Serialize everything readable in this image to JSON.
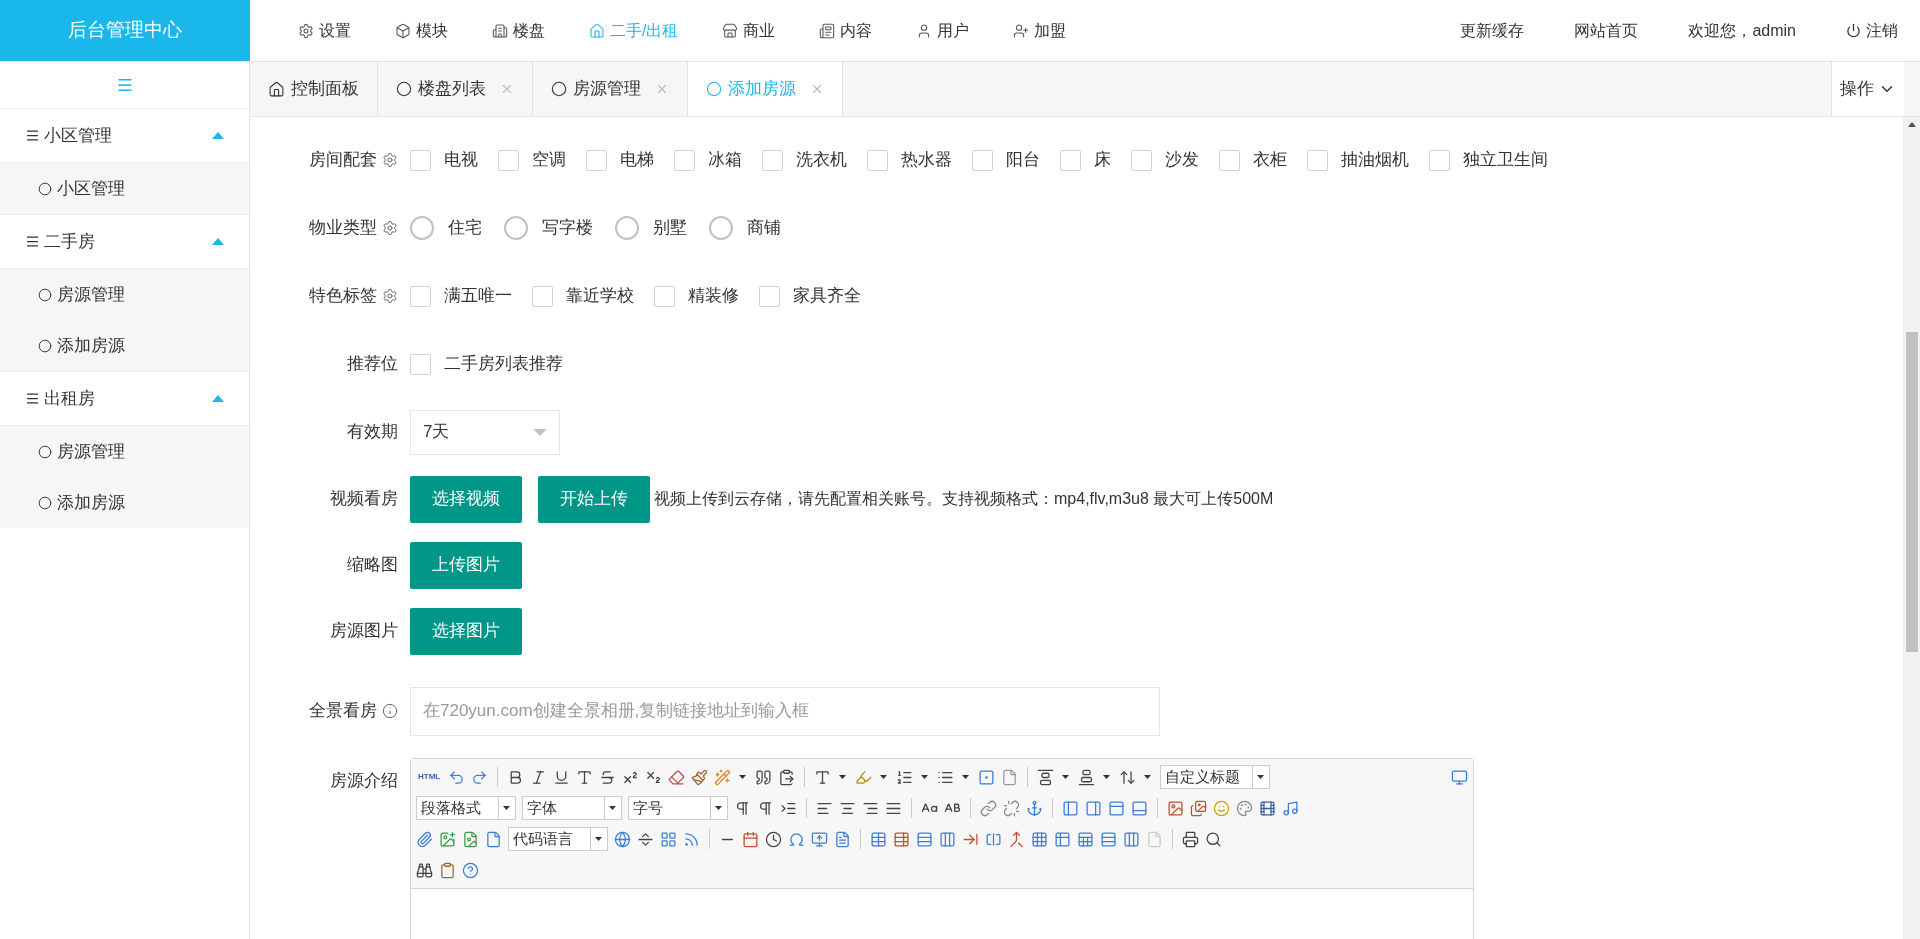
{
  "header": {
    "logo": "后台管理中心",
    "nav": [
      {
        "label": "设置",
        "selected": false
      },
      {
        "label": "模块",
        "selected": false
      },
      {
        "label": "楼盘",
        "selected": false
      },
      {
        "label": "二手/出租",
        "selected": true
      },
      {
        "label": "商业",
        "selected": false
      },
      {
        "label": "内容",
        "selected": false
      },
      {
        "label": "用户",
        "selected": false
      },
      {
        "label": "加盟",
        "selected": false
      }
    ],
    "links": [
      "更新缓存",
      "网站首页"
    ],
    "welcome": "欢迎您，admin",
    "logout": "注销"
  },
  "sidebar": {
    "groups": [
      {
        "title": "小区管理",
        "expanded": true,
        "items": [
          {
            "label": "小区管理",
            "selected": false
          }
        ]
      },
      {
        "title": "二手房",
        "expanded": true,
        "items": [
          {
            "label": "房源管理",
            "selected": false
          },
          {
            "label": "添加房源",
            "selected": false
          }
        ]
      },
      {
        "title": "出租房",
        "expanded": true,
        "items": [
          {
            "label": "房源管理",
            "selected": false
          },
          {
            "label": "添加房源",
            "selected": false
          }
        ]
      }
    ]
  },
  "tabs": [
    {
      "label": "控制面板",
      "kind": "home",
      "selected": false
    },
    {
      "label": "楼盘列表",
      "kind": "page",
      "selected": false
    },
    {
      "label": "房源管理",
      "kind": "page",
      "selected": false
    },
    {
      "label": "添加房源",
      "kind": "page",
      "selected": true
    }
  ],
  "tab_menu": "操作",
  "form": [
    {
      "kind": "checkboxes",
      "label": "房间配套",
      "settings_button": true,
      "options": [
        {
          "label": "电视",
          "checked": false
        },
        {
          "label": "空调",
          "checked": false
        },
        {
          "label": "电梯",
          "checked": false
        },
        {
          "label": "冰箱",
          "checked": false
        },
        {
          "label": "洗衣机",
          "checked": false
        },
        {
          "label": "热水器",
          "checked": false
        },
        {
          "label": "阳台",
          "checked": false
        },
        {
          "label": "床",
          "checked": false
        },
        {
          "label": "沙发",
          "checked": false
        },
        {
          "label": "衣柜",
          "checked": false
        },
        {
          "label": "抽油烟机",
          "checked": false
        },
        {
          "label": "独立卫生间",
          "checked": false
        }
      ]
    },
    {
      "kind": "radios",
      "label": "物业类型",
      "settings_button": true,
      "options": [
        {
          "label": "住宅",
          "selected": false
        },
        {
          "label": "写字楼",
          "selected": false
        },
        {
          "label": "别墅",
          "selected": false
        },
        {
          "label": "商铺",
          "selected": false
        }
      ]
    },
    {
      "kind": "checkboxes",
      "label": "特色标签",
      "settings_button": true,
      "options": [
        {
          "label": "满五唯一",
          "checked": false
        },
        {
          "label": "靠近学校",
          "checked": false
        },
        {
          "label": "精装修",
          "checked": false
        },
        {
          "label": "家具齐全",
          "checked": false
        }
      ]
    },
    {
      "kind": "checkboxes",
      "label": "推荐位",
      "options": [
        {
          "label": "二手房列表推荐",
          "checked": false
        }
      ]
    },
    {
      "kind": "select",
      "label": "有效期",
      "value": "7天"
    },
    {
      "kind": "buttons",
      "label": "视频看房",
      "buttons": [
        "选择视频",
        "开始上传"
      ],
      "note": "视频上传到云存储，请先配置相关账号。支持视频格式：mp4,flv,m3u8 最大可上传500M"
    },
    {
      "kind": "buttons",
      "label": "缩略图",
      "buttons": [
        "上传图片"
      ]
    },
    {
      "kind": "buttons",
      "label": "房源图片",
      "buttons": [
        "选择图片"
      ]
    },
    {
      "kind": "text",
      "label": "全景看房",
      "info_tip": true,
      "placeholder": "在720yun.com创建全景相册,复制链接地址到输入框"
    },
    {
      "kind": "editor",
      "label": "房源介绍",
      "html_label": "HTML",
      "selects": [
        "自定义标题",
        "段落格式",
        "字体",
        "字号",
        "代码语言"
      ]
    }
  ]
}
